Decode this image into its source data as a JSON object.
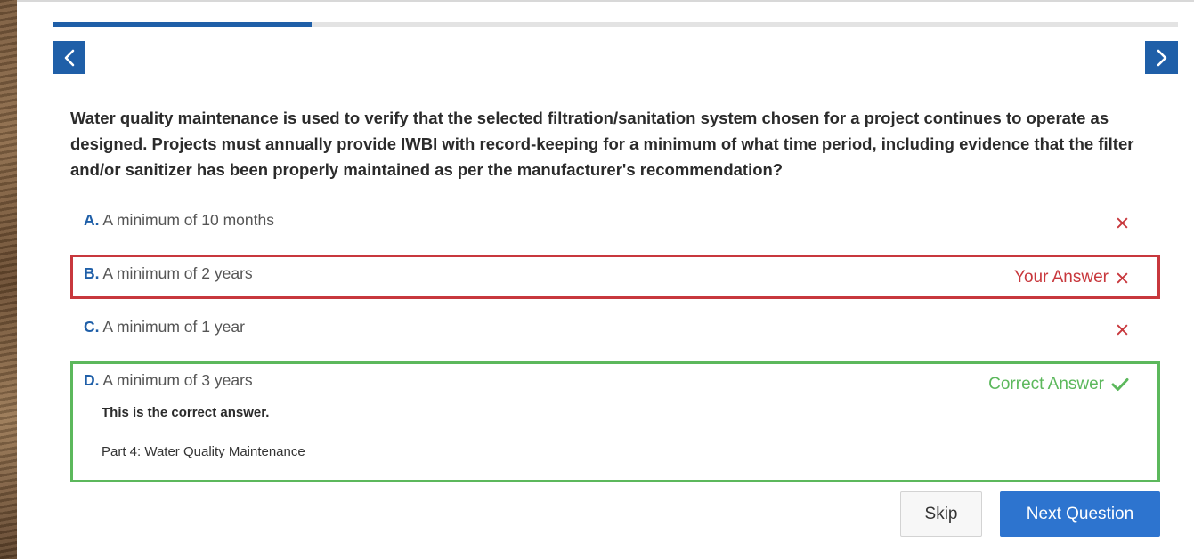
{
  "progress": {
    "fraction": 0.23
  },
  "nav": {
    "prev_icon": "chevron-left-icon",
    "next_icon": "chevron-right-icon"
  },
  "question": {
    "text": "Water quality maintenance is used to verify that the selected filtration/sanitation system chosen for a project continues to operate as designed. Projects must annually provide IWBI with record-keeping for a minimum of what time period, including evidence that the filter and/or sanitizer has been properly maintained as per the manufacturer's recommendation?"
  },
  "options": [
    {
      "letter": "A.",
      "text": "A minimum of 10 months",
      "status": ""
    },
    {
      "letter": "B.",
      "text": "A minimum of 2 years",
      "status": "Your Answer"
    },
    {
      "letter": "C.",
      "text": "A minimum of 1 year",
      "status": ""
    },
    {
      "letter": "D.",
      "text": "A minimum of 3 years",
      "status": "Correct Answer"
    }
  ],
  "feedback": {
    "title": "This is the correct answer.",
    "reference": "Part 4: Water Quality Maintenance"
  },
  "buttons": {
    "skip": "Skip",
    "next": "Next Question"
  },
  "colors": {
    "primary": "#1f5fa8",
    "wrong": "#c8383d",
    "correct": "#5cb85c",
    "button": "#2d74cf"
  }
}
